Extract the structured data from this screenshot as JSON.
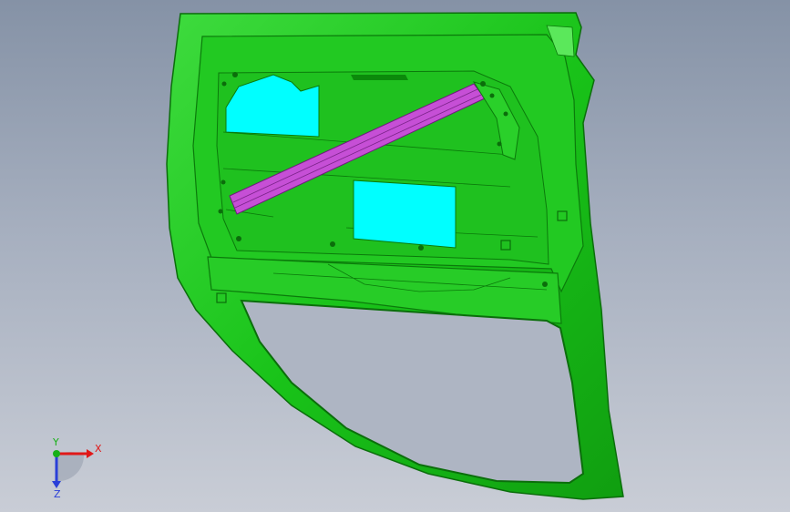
{
  "viewport": {
    "background_top": "#8592a6",
    "background_bottom": "#c9cdd6"
  },
  "model": {
    "part_color": "#19c319",
    "part_color_dark": "#0b8a0b",
    "accent_color": "#00ffff",
    "beam_color": "#c64fd6"
  },
  "triad": {
    "x_label": "X",
    "y_label": "Y",
    "z_label": "Z",
    "x_color": "#e01818",
    "y_color": "#18b018",
    "z_color": "#2a3fd8"
  }
}
